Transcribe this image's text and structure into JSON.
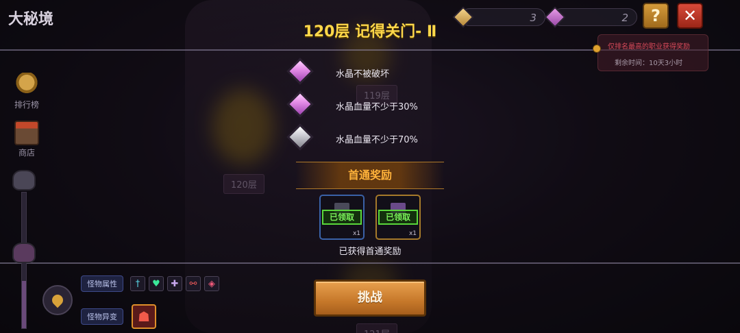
{
  "header": {
    "mode_title": "大秘境",
    "page_title": "120层 记得关门- Ⅱ",
    "counter_gold": "3",
    "counter_purple": "2",
    "help_label": "?",
    "close_label": "✕"
  },
  "notice": {
    "line1": "仅排名最高的职业获得奖励",
    "line2": "剩余时间：10天3小时"
  },
  "sidebar": {
    "ranking_label": "排行榜",
    "shop_label": "商店",
    "floor_progress_fraction": 0.35
  },
  "floors": {
    "upper": "119层",
    "current": "120层",
    "lower": "121层"
  },
  "objectives": [
    {
      "text": "水晶不被破坏",
      "gem": "purple",
      "completed": true
    },
    {
      "text": "水晶血量不少于30%",
      "gem": "purple",
      "completed": true
    },
    {
      "text": "水晶血量不少于70%",
      "gem": "grey",
      "completed": false
    }
  ],
  "rewards": {
    "banner": "首通奖励",
    "items": [
      {
        "stamp": "已领取",
        "qty": "x1",
        "frame": "#3a62a8"
      },
      {
        "stamp": "已领取",
        "qty": "x1",
        "frame": "#a67a2a"
      }
    ],
    "claimed_text": "已获得首通奖励"
  },
  "monster": {
    "attr_label": "怪物属性",
    "mutation_label": "怪物异变",
    "attr_icons": [
      "sword-icon",
      "heart-icon",
      "shield-plus-icon",
      "split-icon",
      "crest-icon"
    ]
  },
  "actions": {
    "challenge_label": "挑战"
  },
  "colors": {
    "title_gold": "#ffd84a",
    "reward_orange": "#ffb23a",
    "claimed_green": "#7af05a",
    "notice_red": "#d84a5a"
  }
}
